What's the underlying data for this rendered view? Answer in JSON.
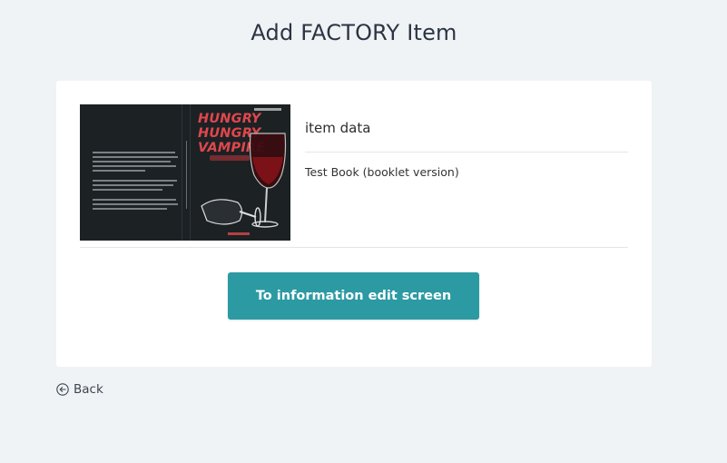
{
  "page": {
    "title": "Add FACTORY Item"
  },
  "item": {
    "cover": {
      "front_title_line1": "HUNGRY",
      "front_title_line2": "HUNGRY",
      "front_title_line3": "VAMPIRE",
      "title_color": "#e0474c",
      "background_color": "#1c2124"
    },
    "section_title": "item data",
    "value": "Test Book (booklet version)"
  },
  "actions": {
    "edit_button_label": "To information edit screen",
    "edit_button_color": "#2c9aa3",
    "back_label": "Back",
    "back_icon": "arrow-left-circle-icon"
  }
}
